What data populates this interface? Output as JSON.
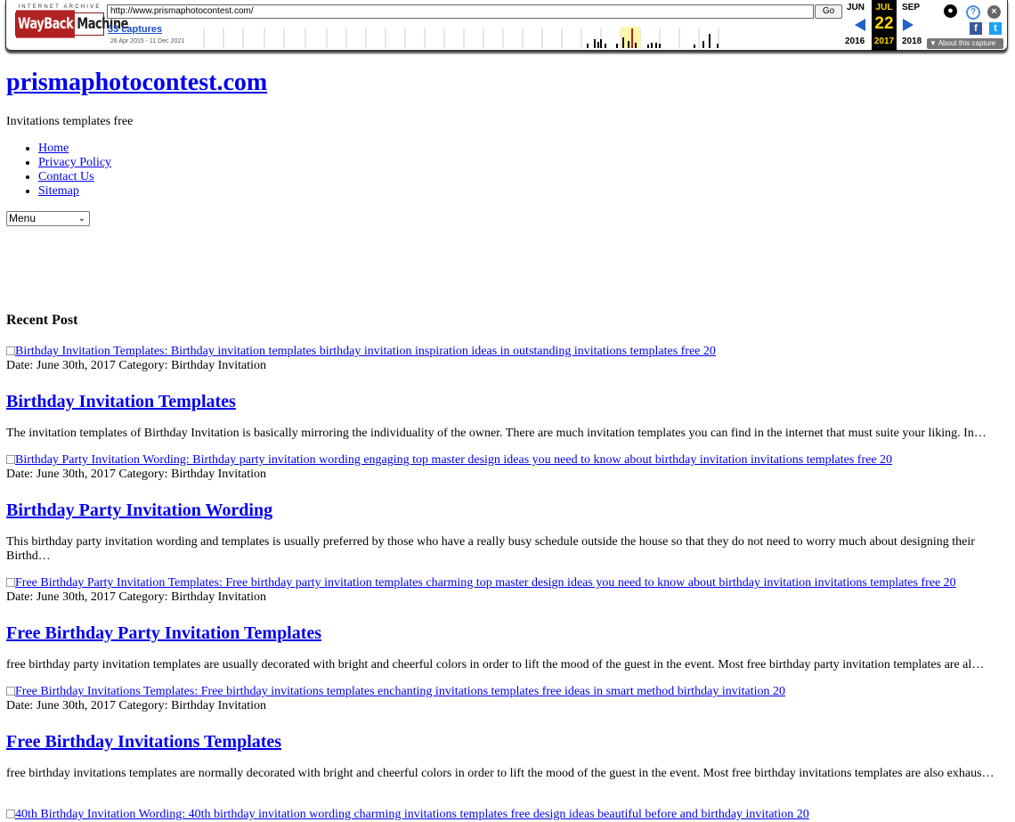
{
  "wayback": {
    "logo_top": "INTERNET ARCHIVE",
    "logo_word1": "WayBack",
    "logo_word2": "Machine",
    "url": "http://www.prismaphotocontest.com/",
    "go_label": "Go",
    "captures_label": "33 captures",
    "date_range": "26 Apr 2015 - 11 Dec 2021",
    "prev_month": "JUN",
    "cur_month": "JUL",
    "next_month": "SEP",
    "cur_day": "22",
    "prev_year": "2016",
    "cur_year": "2017",
    "next_year": "2018",
    "about_label": "About this capture",
    "colors": {
      "accent": "#2360c8",
      "highlight": "#ffd800",
      "capture": "#b22222"
    }
  },
  "site": {
    "title": "prismaphotocontest.com",
    "tagline": "Invitations templates free",
    "nav": [
      "Home",
      "Privacy Policy",
      "Contact Us",
      "Sitemap"
    ],
    "menu_select": "Menu",
    "recent_heading": "Recent Post"
  },
  "posts": [
    {
      "image_alt": "Birthday Invitation Templates: Birthday invitation templates birthday invitation inspiration ideas in outstanding invitations templates free 20",
      "meta": "Date: June 30th, 2017 Category: Birthday Invitation",
      "title": "Birthday Invitation Templates",
      "excerpt": "The invitation templates of Birthday Invitation is basically mirroring the individuality of the owner. There are much invitation templates you can find in the internet that must suite your liking. In…"
    },
    {
      "image_alt": "Birthday Party Invitation Wording: Birthday party invitation wording engaging top master design ideas you need to know about birthday invitation invitations templates free 20",
      "meta": "Date: June 30th, 2017 Category: Birthday Invitation",
      "title": "Birthday Party Invitation Wording",
      "excerpt": "This birthday party invitation wording and templates is usually preferred by those who have a really busy schedule outside the house so that they do not need to worry much about designing their Birthd…"
    },
    {
      "image_alt": "Free Birthday Party Invitation Templates: Free birthday party invitation templates charming top master design ideas you need to know about birthday invitation invitations templates free 20",
      "meta": "Date: June 30th, 2017 Category: Birthday Invitation",
      "title": "Free Birthday Party Invitation Templates",
      "excerpt": "free birthday party invitation templates are usually decorated with bright and cheerful colors in order to lift the mood of the guest in the event. Most free birthday party invitation templates are al…"
    },
    {
      "image_alt": "Free Birthday Invitations Templates: Free birthday invitations templates enchanting invitations templates free ideas in smart method birthday invitation 20",
      "meta": "Date: June 30th, 2017 Category: Birthday Invitation",
      "title": "Free Birthday Invitations Templates",
      "excerpt": "free birthday invitations templates are normally decorated with bright and cheerful colors in order to lift the mood of the guest in the event. Most free birthday invitations templates are also exhaus…"
    },
    {
      "image_alt": "40th Birthday Invitation Wording: 40th birthday invitation wording charming invitations templates free design ideas beautiful before and birthday invitation 20"
    }
  ]
}
